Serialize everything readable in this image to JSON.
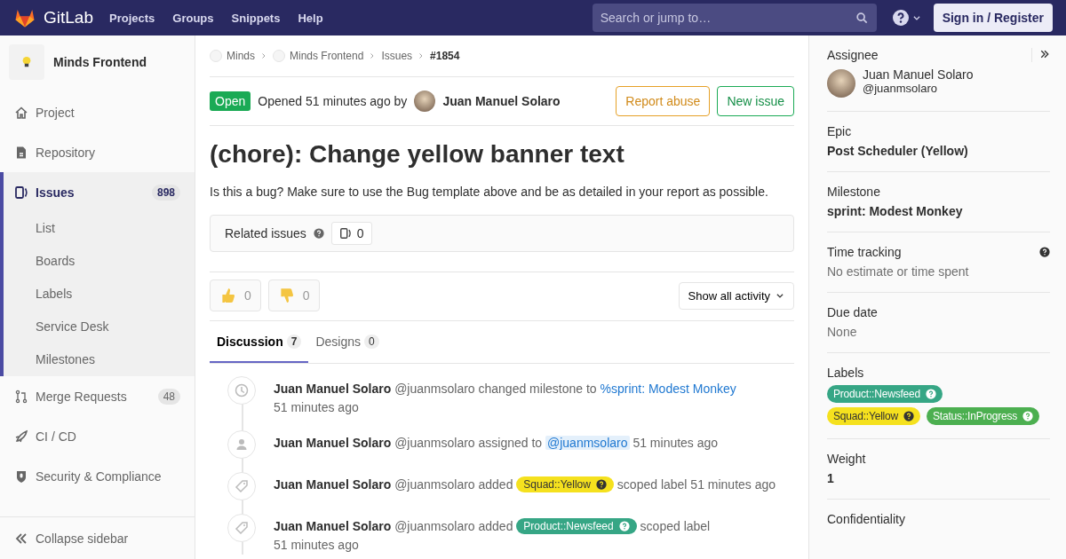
{
  "topbar": {
    "brand": "GitLab",
    "nav": [
      "Projects",
      "Groups",
      "Snippets",
      "Help"
    ],
    "search": {
      "placeholder": "Search or jump to…"
    },
    "signin": "Sign in / Register"
  },
  "sidebar": {
    "project": "Minds Frontend",
    "items": [
      {
        "label": "Project",
        "selected": false
      },
      {
        "label": "Repository",
        "selected": false
      },
      {
        "label": "Issues",
        "selected": true,
        "badge": "898",
        "children": [
          "List",
          "Boards",
          "Labels",
          "Service Desk",
          "Milestones"
        ]
      },
      {
        "label": "Merge Requests",
        "selected": false,
        "badge": "48"
      },
      {
        "label": "CI / CD",
        "selected": false
      },
      {
        "label": "Security & Compliance",
        "selected": false
      }
    ],
    "collapse": "Collapse sidebar"
  },
  "breadcrumbs": [
    {
      "label": "Minds",
      "avatar": true,
      "current": false
    },
    {
      "label": "Minds Frontend",
      "avatar": true,
      "current": false
    },
    {
      "label": "Issues",
      "avatar": false,
      "current": false
    },
    {
      "label": "#1854",
      "avatar": false,
      "current": true
    }
  ],
  "issue": {
    "status": "Open",
    "opened": "Opened 51 minutes ago by",
    "author": "Juan Manuel Solaro",
    "report": "Report abuse",
    "new_issue": "New issue",
    "title": "(chore): Change yellow banner text",
    "description": "Is this a bug? Make sure to use the Bug template above and be as detailed in your report as possible."
  },
  "related": {
    "label": "Related issues",
    "count": "0"
  },
  "awards": [
    {
      "kind": "up",
      "count": "0"
    },
    {
      "kind": "down",
      "count": "0"
    }
  ],
  "activity_filter": "Show all activity",
  "tabs": [
    {
      "label": "Discussion",
      "count": "7",
      "selected": true
    },
    {
      "label": "Designs",
      "count": "0",
      "selected": false
    }
  ],
  "events": [
    {
      "kind": "clock",
      "author": "Juan Manuel Solaro",
      "parts": [
        {
          "kind": "text",
          "text": "@juanmsolaro changed milestone to"
        },
        {
          "kind": "link",
          "text": "%sprint: Modest Monkey"
        },
        {
          "kind": "time",
          "text": "51 minutes ago"
        }
      ]
    },
    {
      "kind": "user",
      "author": "Juan Manuel Solaro",
      "parts": [
        {
          "kind": "text",
          "text": "@juanmsolaro assigned to"
        },
        {
          "kind": "mention",
          "text": "@juanmsolaro"
        },
        {
          "kind": "time",
          "text": "51 minutes ago"
        }
      ]
    },
    {
      "kind": "tag",
      "author": "Juan Manuel Solaro",
      "parts": [
        {
          "kind": "text",
          "text": "@juanmsolaro added"
        },
        {
          "kind": "label",
          "text": "Squad::Yellow",
          "color": "#f5e11e"
        },
        {
          "kind": "text",
          "text": "scoped label 51 minutes ago"
        }
      ]
    },
    {
      "kind": "tag",
      "author": "Juan Manuel Solaro",
      "parts": [
        {
          "kind": "text",
          "text": "@juanmsolaro added"
        },
        {
          "kind": "label",
          "text": "Product::Newsfeed",
          "color": "#36a685"
        },
        {
          "kind": "text",
          "text": "scoped label"
        },
        {
          "kind": "time",
          "text": "51 minutes ago"
        }
      ]
    }
  ],
  "right": {
    "assignee": {
      "title": "Assignee",
      "name": "Juan Manuel Solaro",
      "username": "@juanmsolaro"
    },
    "blocks": [
      {
        "kind": "value",
        "title": "Epic",
        "value": "Post Scheduler (Yellow)",
        "strong": true
      },
      {
        "kind": "value",
        "title": "Milestone",
        "value": "sprint: Modest Monkey",
        "strong": true
      },
      {
        "kind": "value",
        "title": "Time tracking",
        "value": "No estimate or time spent",
        "strong": false,
        "help": true
      },
      {
        "kind": "value",
        "title": "Due date",
        "value": "None",
        "strong": false
      },
      {
        "kind": "labels",
        "title": "Labels",
        "labels": [
          {
            "text": "Product::Newsfeed",
            "color": "#36a685"
          },
          {
            "text": "Squad::Yellow",
            "color": "#f5e11e"
          },
          {
            "text": "Status::InProgress",
            "color": "#4caf50"
          }
        ]
      },
      {
        "kind": "value",
        "title": "Weight",
        "value": "1",
        "strong": true
      },
      {
        "kind": "title",
        "title": "Confidentiality"
      }
    ]
  }
}
